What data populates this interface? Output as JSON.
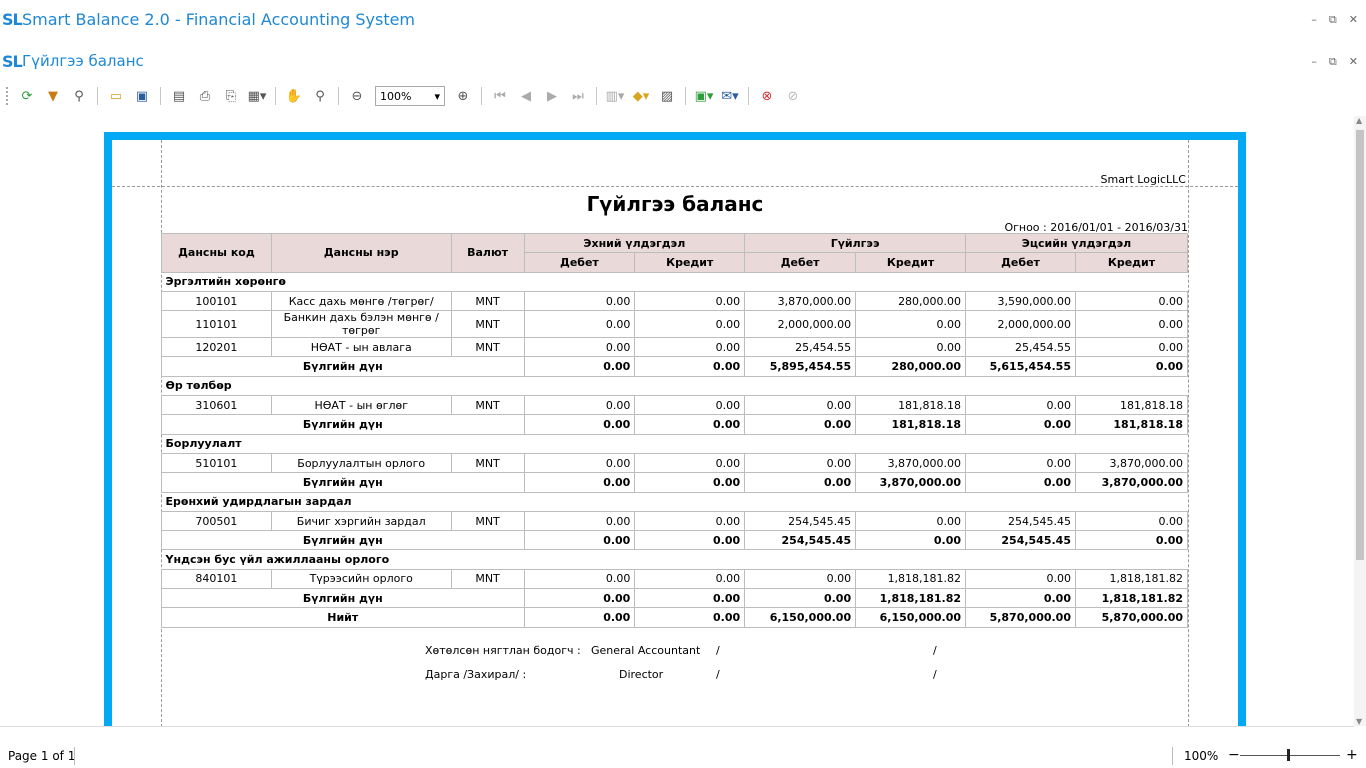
{
  "app": {
    "logo": "SL",
    "title": "Smart Balance 2.0 - Financial Accounting System"
  },
  "doc_tab": {
    "logo": "SL",
    "title": "Гүйлгээ баланс"
  },
  "window_controls": {
    "minimize": "–",
    "restore": "⧉",
    "close": "✕"
  },
  "toolbar": {
    "zoom_value": "100%",
    "icons": [
      "refresh-icon",
      "filter-icon",
      "find-icon",
      "open-icon",
      "save-icon",
      "page-setup-icon",
      "print-icon",
      "quick-print-icon",
      "export-icon",
      "hand-tool-icon",
      "magnifier-icon",
      "zoom-out-icon",
      "zoom-in-icon",
      "first-page-icon",
      "prev-page-icon",
      "next-page-icon",
      "last-page-icon",
      "multi-page-icon",
      "color-icon",
      "watermark-icon",
      "export-file-icon",
      "email-icon",
      "close-preview-icon",
      "stop-icon"
    ]
  },
  "report": {
    "company": "Smart LogicLLC",
    "title": "Гүйлгээ баланс",
    "period": "Огноо : 2016/01/01 - 2016/03/31",
    "headers": {
      "code": "Дансны код",
      "name": "Дансны нэр",
      "currency": "Валют",
      "opening": "Эхний үлдэгдэл",
      "turnover": "Гүйлгээ",
      "closing": "Эцсийн үлдэгдэл",
      "debit": "Дебет",
      "credit": "Кредит"
    },
    "sections": [
      {
        "title": "Эргэлтийн хөрөнгө",
        "rows": [
          {
            "code": "100101",
            "name": "Касс дахь мөнгө /төгрөг/",
            "cur": "MNT",
            "v": [
              "0.00",
              "0.00",
              "3,870,000.00",
              "280,000.00",
              "3,590,000.00",
              "0.00"
            ]
          },
          {
            "code": "110101",
            "name": "Банкин дахь бэлэн мөнгө /төгрөг",
            "cur": "MNT",
            "v": [
              "0.00",
              "0.00",
              "2,000,000.00",
              "0.00",
              "2,000,000.00",
              "0.00"
            ]
          },
          {
            "code": "120201",
            "name": "НӨАТ - ын авлага",
            "cur": "MNT",
            "v": [
              "0.00",
              "0.00",
              "25,454.55",
              "0.00",
              "25,454.55",
              "0.00"
            ]
          }
        ],
        "total_label": "Бүлгийн дүн",
        "total": [
          "0.00",
          "0.00",
          "5,895,454.55",
          "280,000.00",
          "5,615,454.55",
          "0.00"
        ]
      },
      {
        "title": "Өр төлбөр",
        "rows": [
          {
            "code": "310601",
            "name": "НӨАТ - ын өглөг",
            "cur": "MNT",
            "v": [
              "0.00",
              "0.00",
              "0.00",
              "181,818.18",
              "0.00",
              "181,818.18"
            ]
          }
        ],
        "total_label": "Бүлгийн дүн",
        "total": [
          "0.00",
          "0.00",
          "0.00",
          "181,818.18",
          "0.00",
          "181,818.18"
        ]
      },
      {
        "title": "Борлуулалт",
        "rows": [
          {
            "code": "510101",
            "name": "Борлуулалтын орлого",
            "cur": "MNT",
            "v": [
              "0.00",
              "0.00",
              "0.00",
              "3,870,000.00",
              "0.00",
              "3,870,000.00"
            ]
          }
        ],
        "total_label": "Бүлгийн дүн",
        "total": [
          "0.00",
          "0.00",
          "0.00",
          "3,870,000.00",
          "0.00",
          "3,870,000.00"
        ]
      },
      {
        "title": "Ерөнхий удирдлагын зардал",
        "rows": [
          {
            "code": "700501",
            "name": "Бичиг хэргийн зардал",
            "cur": "MNT",
            "v": [
              "0.00",
              "0.00",
              "254,545.45",
              "0.00",
              "254,545.45",
              "0.00"
            ]
          }
        ],
        "total_label": "Бүлгийн дүн",
        "total": [
          "0.00",
          "0.00",
          "254,545.45",
          "0.00",
          "254,545.45",
          "0.00"
        ]
      },
      {
        "title": "Үндсэн бус үйл ажиллааны орлого",
        "rows": [
          {
            "code": "840101",
            "name": "Түрээсийн орлого",
            "cur": "MNT",
            "v": [
              "0.00",
              "0.00",
              "0.00",
              "1,818,181.82",
              "0.00",
              "1,818,181.82"
            ]
          }
        ],
        "total_label": "Бүлгийн дүн",
        "total": [
          "0.00",
          "0.00",
          "0.00",
          "1,818,181.82",
          "0.00",
          "1,818,181.82"
        ]
      }
    ],
    "grand_total_label": "Нийт",
    "grand_total": [
      "0.00",
      "0.00",
      "6,150,000.00",
      "6,150,000.00",
      "5,870,000.00",
      "5,870,000.00"
    ],
    "signatures": [
      {
        "label": "Хөтөлсөн нягтлан бодогч :",
        "person": "General Accountant",
        "slash1": "/",
        "slash2": "/"
      },
      {
        "label": "Дарга /Захирал/ :",
        "person": "Director",
        "slash1": "/",
        "slash2": "/"
      }
    ]
  },
  "status": {
    "page": "Page 1 of 1",
    "zoom": "100%",
    "minus": "−",
    "plus": "+"
  }
}
